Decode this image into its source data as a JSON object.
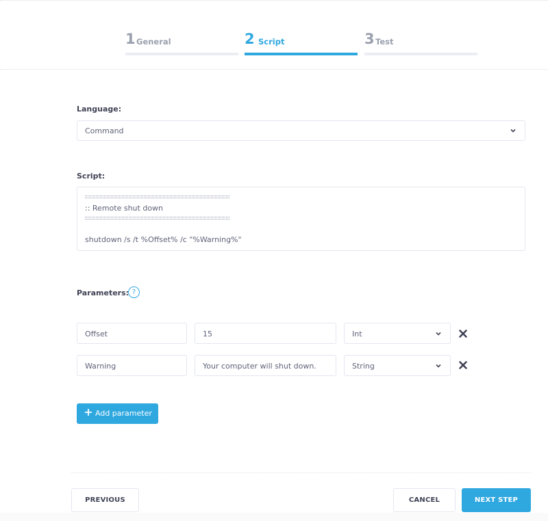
{
  "wizard": {
    "steps": [
      {
        "number": "1",
        "label": "General",
        "state": "inactive"
      },
      {
        "number": "2",
        "label": "Script",
        "state": "active"
      },
      {
        "number": "3",
        "label": "Test",
        "state": "inactive"
      }
    ],
    "accent_color": "#2fa8e0"
  },
  "form": {
    "language": {
      "label": "Language:",
      "value": "Command"
    },
    "script": {
      "label": "Script:",
      "lines": [
        "::::::::::::::::::::::::::::::::::::::::::::::::::::::::::::::::::::::::",
        ":: Remote shut down",
        "::::::::::::::::::::::::::::::::::::::::::::::::::::::::::::::::::::::::",
        "",
        "shutdown /s /t %Offset% /c \"%Warning%\""
      ]
    },
    "parameters": {
      "label": "Parameters:",
      "help_icon": "?",
      "rows": [
        {
          "name": "Offset",
          "value": "15",
          "type": "Int"
        },
        {
          "name": "Warning",
          "value": "Your computer will shut down.",
          "type": "String"
        }
      ],
      "add_label": "Add parameter"
    }
  },
  "footer": {
    "previous_label": "PREVIOUS",
    "cancel_label": "CANCEL",
    "next_label": "NEXT STEP"
  }
}
